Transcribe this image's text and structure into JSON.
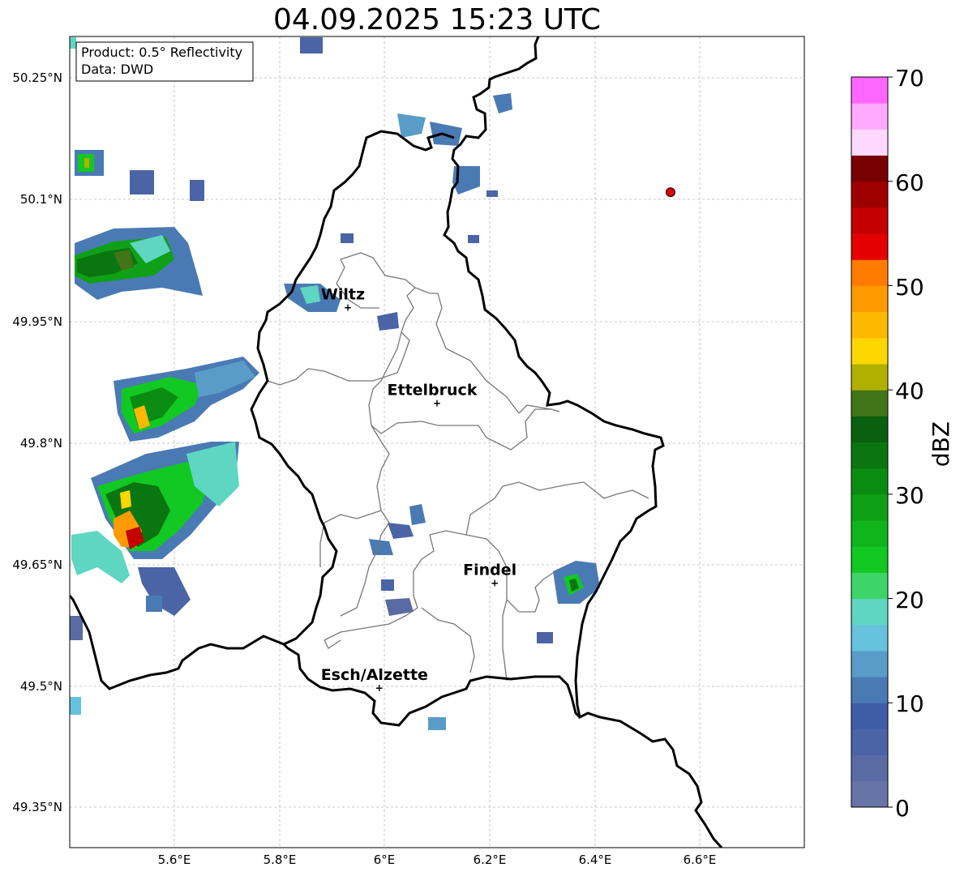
{
  "title": "04.09.2025 15:23 UTC",
  "info_box": {
    "product": "Product: 0.5° Reflectivity",
    "data": "Data: DWD"
  },
  "lat_ticks": [
    "50.25°N",
    "50.1°N",
    "49.95°N",
    "49.8°N",
    "49.65°N",
    "49.5°N",
    "49.35°N"
  ],
  "lon_ticks": [
    "5.6°E",
    "5.8°E",
    "6°E",
    "6.2°E",
    "6.4°E",
    "6.6°E"
  ],
  "cities": [
    {
      "name": "Wiltz",
      "lon": 5.93,
      "lat": 49.966
    },
    {
      "name": "Ettelbruck",
      "lon": 6.1,
      "lat": 49.848
    },
    {
      "name": "Findel",
      "lon": 6.21,
      "lat": 49.626
    },
    {
      "name": "Esch/Alzette",
      "lon": 5.99,
      "lat": 49.497
    }
  ],
  "red_marker": {
    "lon": 6.545,
    "lat": 50.108,
    "color": "#dd0000"
  },
  "colorbar": {
    "label": "dBZ",
    "ticks": [
      "0",
      "10",
      "20",
      "30",
      "40",
      "50",
      "60",
      "70"
    ],
    "colors": [
      "#6674a6",
      "#5a6aa2",
      "#4a64a6",
      "#3f5ca8",
      "#4a7ab4",
      "#5a9cc8",
      "#66c2dd",
      "#5ed6c2",
      "#3ed46a",
      "#12c822",
      "#10b41c",
      "#10a018",
      "#0a8c12",
      "#0a7610",
      "#0a600e",
      "#427418",
      "#b0b000",
      "#ffd700",
      "#ffb800",
      "#ff9a00",
      "#ff7c00",
      "#e40000",
      "#c40000",
      "#9e0000",
      "#780000",
      "#ffd8ff",
      "#ffaaff",
      "#ff66ff",
      "#e830e8"
    ]
  },
  "map_extent": {
    "lon_min": 5.4,
    "lon_max": 6.8,
    "lat_min": 49.3,
    "lat_max": 50.3
  }
}
